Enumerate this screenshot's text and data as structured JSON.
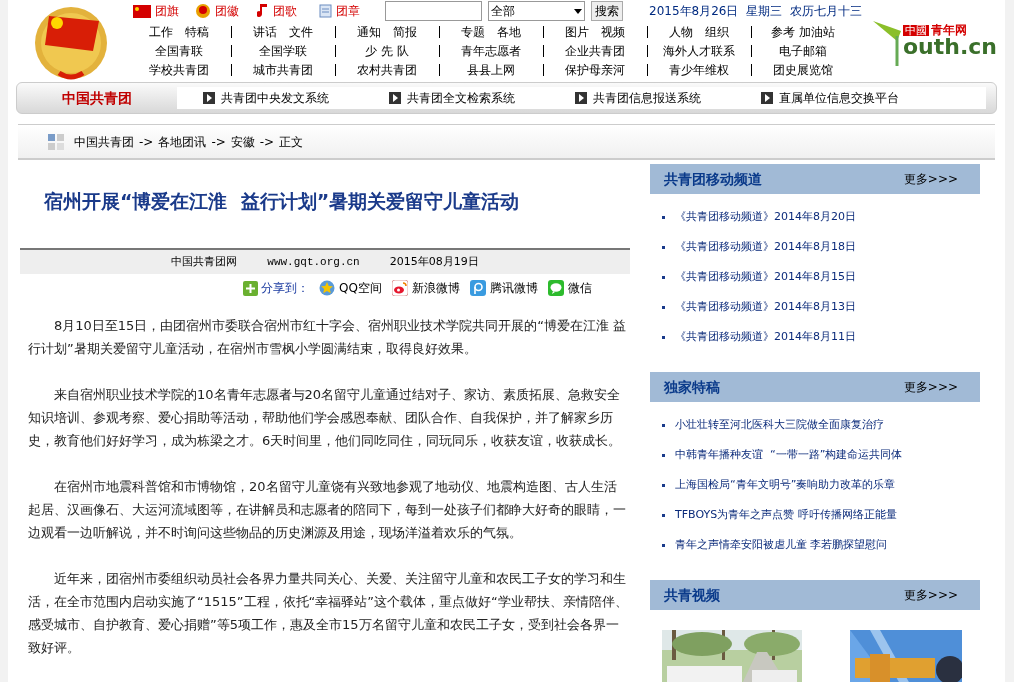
{
  "top_links": [
    {
      "label": "团旗"
    },
    {
      "label": "团徽"
    },
    {
      "label": "团歌"
    },
    {
      "label": "团章"
    }
  ],
  "search": {
    "scope": "全部",
    "button": "搜索"
  },
  "date": "2015年8月26日  星期三  农历七月十三",
  "nav_rows": [
    [
      "工作　特稿",
      "讲话　文件",
      "通知　简报",
      "专题　各地",
      "图片　视频",
      "人物　组织",
      "参考 加油站"
    ],
    [
      "全国青联",
      "全国学联",
      "少 先 队",
      "青年志愿者",
      "企业共青团",
      "海外人才联系",
      "电子邮箱"
    ],
    [
      "学校共青团",
      "城市共青团",
      "农村共青团",
      "县县上网",
      "保护母亲河",
      "青少年维权",
      "团史展览馆"
    ]
  ],
  "youth_logo": {
    "badge": "中國",
    "text": "青年网",
    "domain": "outh.cn"
  },
  "system_bar": {
    "title": "中国共青团",
    "links": [
      "共青团中央发文系统",
      "共青团全文检索系统",
      "共青团信息报送系统",
      "直属单位信息交换平台"
    ]
  },
  "breadcrumb": {
    "separator": "->",
    "items": [
      "中国共青团",
      "各地团讯",
      "安徽",
      "正文"
    ]
  },
  "article": {
    "title": "宿州开展“博爱在江淮  益行计划”暑期关爱留守儿童活动",
    "source": "中国共青团网",
    "site": "www.gqt.org.cn",
    "date": "2015年08月19日",
    "share_label": "分享到：",
    "share": [
      {
        "label": "QQ空间"
      },
      {
        "label": "新浪微博"
      },
      {
        "label": "腾讯微博"
      },
      {
        "label": "微信"
      }
    ],
    "paragraphs": [
      "8月10日至15日，由团宿州市委联合宿州市红十字会、宿州职业技术学院共同开展的“博爱在江淮  益行计划”暑期关爱留守儿童活动，在宿州市雪枫小学圆满结束，取得良好效果。",
      "来自宿州职业技术学院的10名青年志愿者与20名留守儿童通过结对子、家访、素质拓展、急救安全知识培训、参观考察、爱心捐助等活动，帮助他们学会感恩奉献、团队合作、自我保护，并了解家乡历史，教育他们好好学习，成为栋梁之才。6天时间里，他们同吃同住，同玩同乐，收获友谊，收获成长。",
      "在宿州市地震科普馆和市博物馆，20名留守儿童饶有兴致地参观了地动仪、地震构造图、古人生活起居、汉画像石、大运河流域图等，在讲解员和志愿者的陪同下，每到一处孩子们都睁大好奇的眼睛，一边观看一边听解说，并不时询问这些物品的历史渊源及用途，现场洋溢着欢乐的气氛。",
      "近年来，团宿州市委组织动员社会各界力量共同关心、关爱、关注留守儿童和农民工子女的学习和生活，在全市范围内启动实施了“1515”工程，依托“幸福驿站”这个载体，重点做好“学业帮扶、亲情陪伴、感受城市、自护教育、爱心捐赠”等5项工作，惠及全市15万名留守儿童和农民工子女，受到社会各界一致好评。"
    ]
  },
  "sidebar": [
    {
      "title": "共青团移动频道",
      "more": "更多>>>",
      "kind": "list",
      "items": [
        "《共青团移动频道》2014年8月20日",
        "《共青团移动频道》2014年8月18日",
        "《共青团移动频道》2014年8月15日",
        "《共青团移动频道》2014年8月13日",
        "《共青团移动频道》2014年8月11日"
      ]
    },
    {
      "title": "独家特稿",
      "more": "更多>>>",
      "kind": "list",
      "items": [
        "小壮壮转至河北医科大三院做全面康复治疗",
        "中韩青年播种友谊  “一带一路”构建命运共同体",
        "上海国检局“青年文明号”奏响助力改革的乐章",
        "TFBOYS为青年之声点赞 呼吁传播网络正能量",
        "青年之声情牵安阳被虐儿童 李若鹏探望慰问"
      ]
    },
    {
      "title": "共青视频",
      "more": "更多>>>",
      "kind": "videos"
    }
  ]
}
